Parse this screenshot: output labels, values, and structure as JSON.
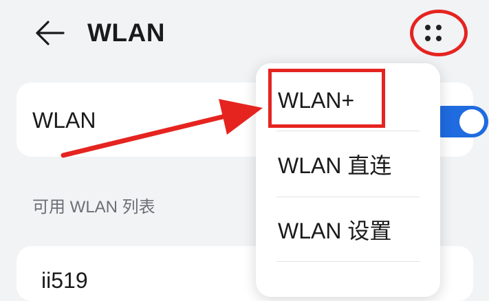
{
  "header": {
    "title": "WLAN",
    "back_icon": "arrow-left-icon",
    "more_icon": "more-dots-icon"
  },
  "wlan_toggle": {
    "label": "WLAN",
    "enabled": true,
    "accent_color": "#1f6be0"
  },
  "available_list": {
    "section_title": "可用 WLAN 列表",
    "items": [
      {
        "label": "ii519"
      }
    ]
  },
  "overflow_menu": {
    "items": [
      {
        "label": "WLAN+"
      },
      {
        "label": "WLAN 直连"
      },
      {
        "label": "WLAN 设置"
      }
    ]
  },
  "annotation": {
    "highlight_color": "#e52420"
  }
}
